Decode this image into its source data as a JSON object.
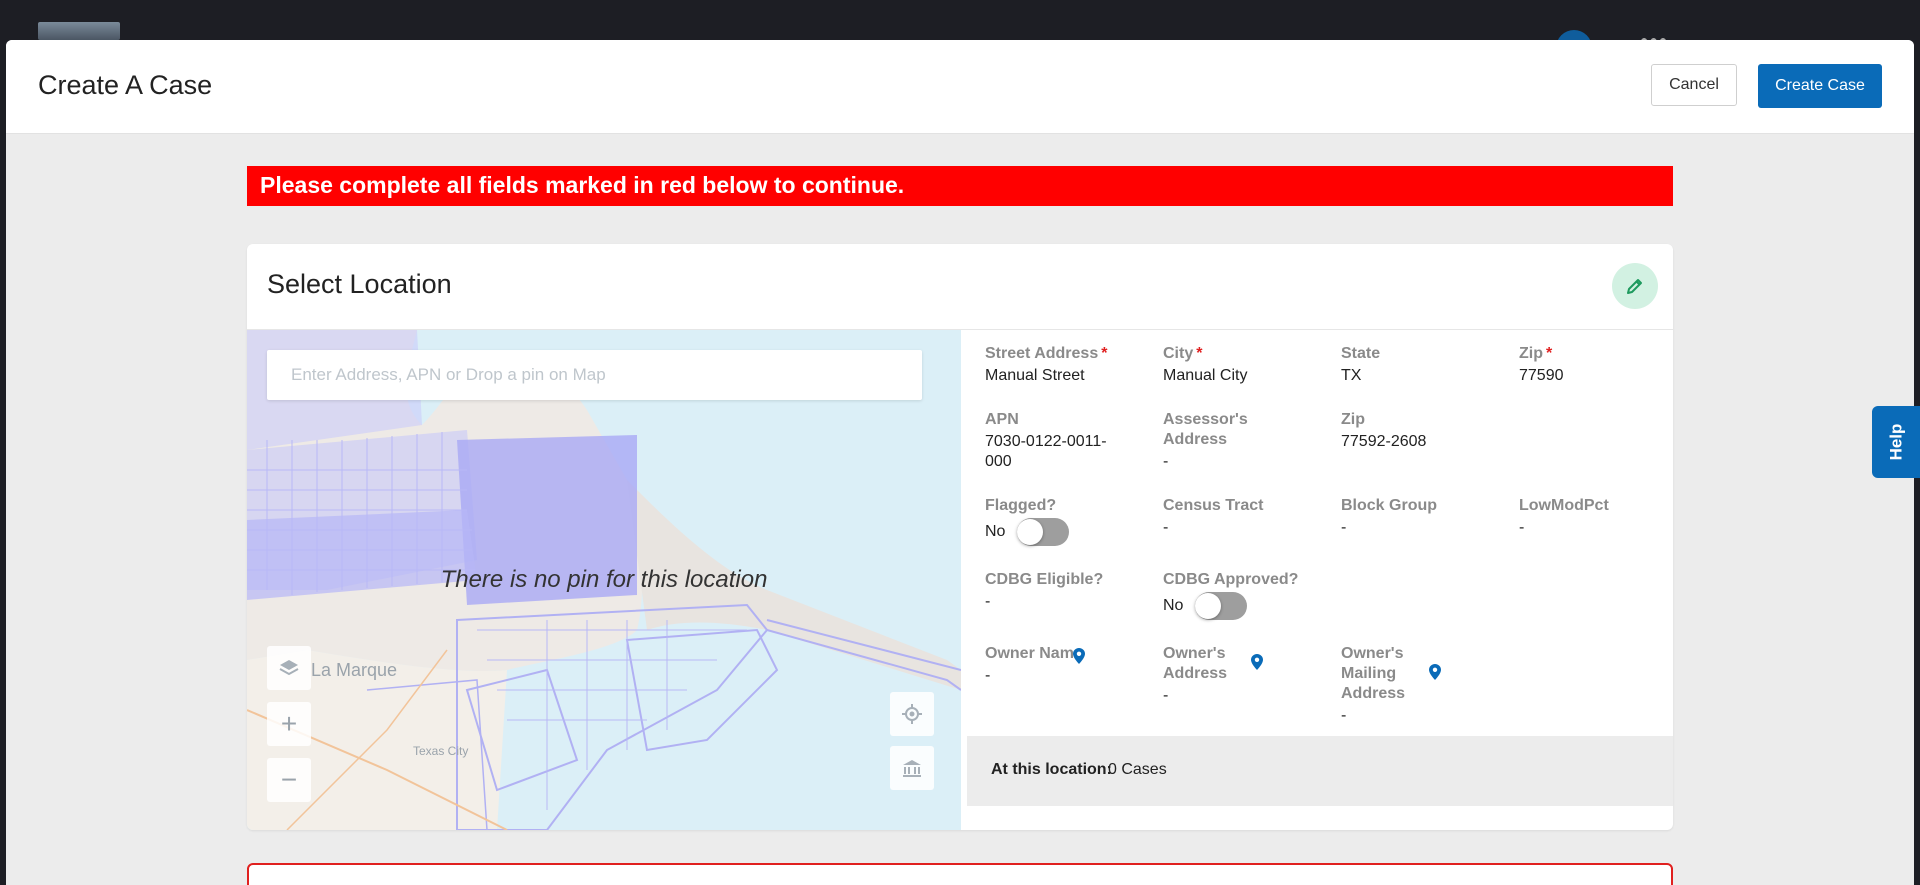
{
  "modal": {
    "title": "Create A Case",
    "cancel_label": "Cancel",
    "create_label": "Create Case"
  },
  "alert": {
    "text": "Please complete all fields marked in red below to continue.",
    "color": "#ff0000"
  },
  "location": {
    "title": "Select Location",
    "edit_icon": "pencil-icon",
    "map": {
      "search_placeholder": "Enter Address, APN or Drop a pin on Map",
      "no_pin_text": "There is no pin for this location",
      "places": [
        "La Marque",
        "Texas City"
      ],
      "controls": [
        "layers-icon",
        "zoom-in-icon",
        "zoom-out-icon",
        "locate-icon",
        "parcel-icon"
      ]
    },
    "fields": {
      "street_address": {
        "label": "Street Address",
        "value": "Manual Street",
        "required": "*"
      },
      "city": {
        "label": "City",
        "value": "Manual City",
        "required": "*"
      },
      "state": {
        "label": "State",
        "value": "TX"
      },
      "zip": {
        "label": "Zip",
        "value": "77590",
        "required": "*"
      },
      "apn": {
        "label": "APN",
        "value": "7030-0122-0011-000"
      },
      "assessor_address": {
        "label": "Assessor's Address",
        "value": "-"
      },
      "zip2": {
        "label": "Zip",
        "value": "77592-2608"
      },
      "flagged": {
        "label": "Flagged?",
        "value": "No"
      },
      "census_tract": {
        "label": "Census Tract",
        "value": "-"
      },
      "block_group": {
        "label": "Block Group",
        "value": "-"
      },
      "lowmodpct": {
        "label": "LowModPct",
        "value": "-"
      },
      "cdbg_eligible": {
        "label": "CDBG Eligible?",
        "value": "-"
      },
      "cdbg_approved": {
        "label": "CDBG Approved?",
        "value": "No"
      },
      "owner_name": {
        "label": "Owner Name",
        "value": "-"
      },
      "owner_address": {
        "label": "Owner's Address",
        "value": "-"
      },
      "owner_mailing": {
        "label": "Owner's Mailing Address",
        "value": "-"
      }
    },
    "at_location": {
      "label": "At this location:",
      "value": "0 Cases"
    }
  },
  "help": {
    "label": "Help"
  },
  "colors": {
    "primary": "#0a6bb8",
    "alert": "#ff0000",
    "edit_bg": "#d2f1e2",
    "required": "#e02020"
  }
}
